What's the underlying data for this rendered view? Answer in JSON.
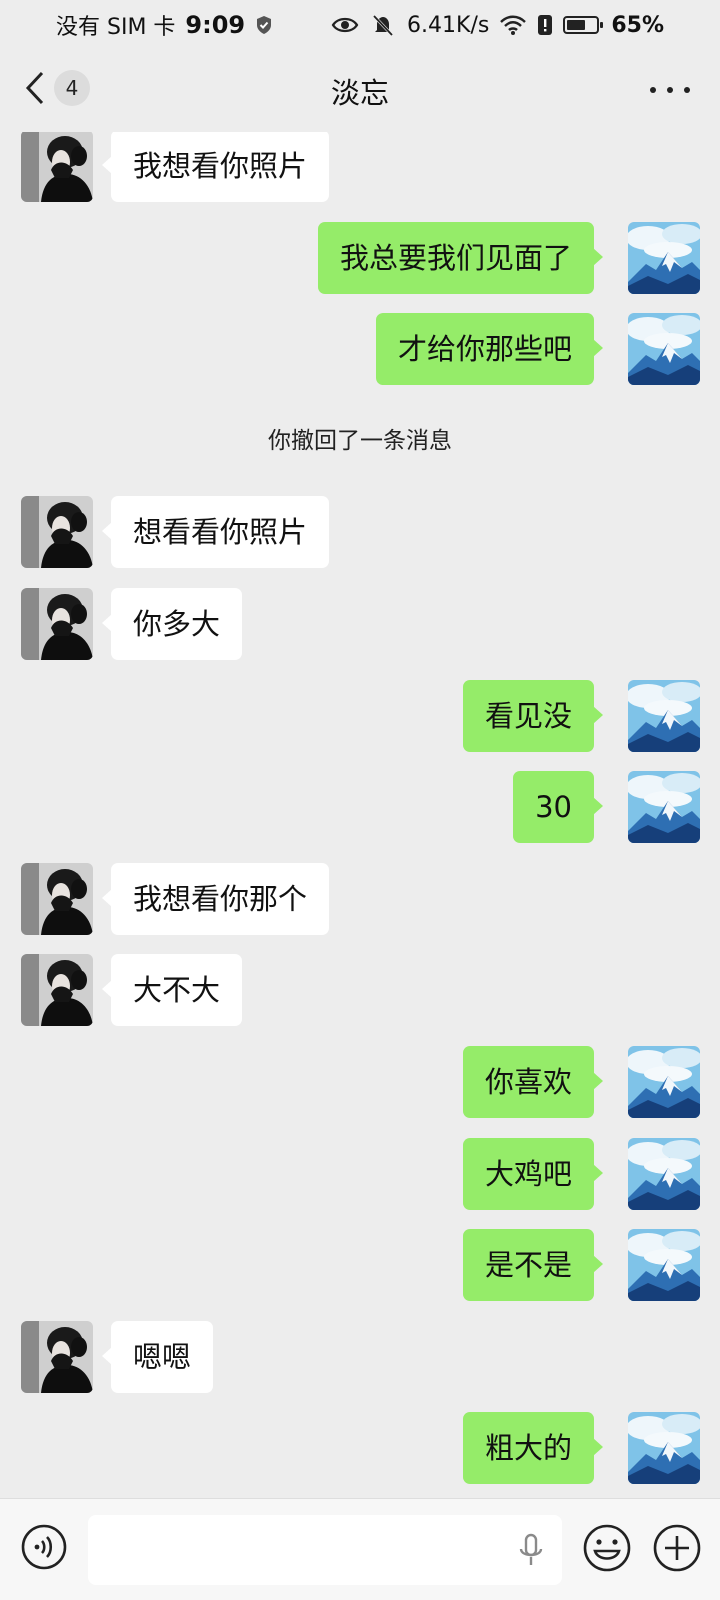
{
  "status_bar": {
    "carrier": "没有 SIM 卡",
    "time": "9:09",
    "net_speed": "6.41K/s",
    "battery_text": "65%",
    "battery_level": 0.65
  },
  "header": {
    "back_count": "4",
    "title": "淡忘"
  },
  "messages": [
    {
      "side": "in",
      "text": "我想看你照片"
    },
    {
      "side": "out",
      "text": "我总要我们见面了"
    },
    {
      "side": "out",
      "text": "才给你那些吧"
    },
    {
      "side": "system",
      "text": "你撤回了一条消息"
    },
    {
      "side": "in",
      "text": "想看看你照片"
    },
    {
      "side": "in",
      "text": "你多大"
    },
    {
      "side": "out",
      "text": "看见没"
    },
    {
      "side": "out",
      "text": "30"
    },
    {
      "side": "in",
      "text": "我想看你那个"
    },
    {
      "side": "in",
      "text": "大不大"
    },
    {
      "side": "out",
      "text": "你喜欢"
    },
    {
      "side": "out",
      "text": "大鸡吧"
    },
    {
      "side": "out",
      "text": "是不是"
    },
    {
      "side": "in",
      "text": "嗯嗯"
    },
    {
      "side": "out",
      "text": "粗大的"
    }
  ],
  "input_bar": {
    "value": "",
    "icons": [
      "voice-icon",
      "microphone-icon",
      "emoji-icon",
      "plus-icon"
    ]
  },
  "colors": {
    "background": "#ededed",
    "outgoing_bubble": "#95ec69",
    "incoming_bubble": "#ffffff"
  }
}
